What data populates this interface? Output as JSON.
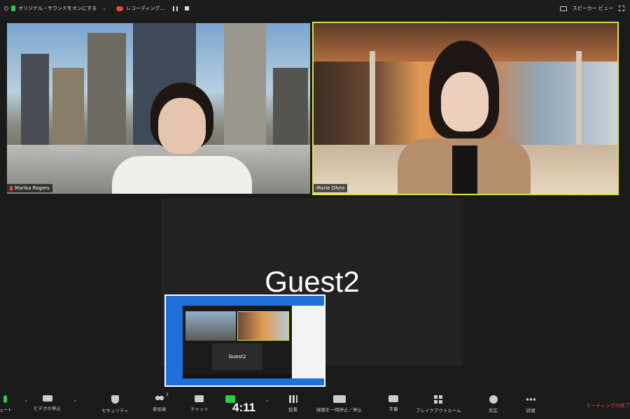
{
  "topbar": {
    "original_sound": "オリジナル・サウンドをオンにする",
    "recording": "レコーディング…",
    "speaker_view": "スピーカー ビュー"
  },
  "participants": [
    {
      "name": "Marika Rogers"
    },
    {
      "name": "Marie Ohno"
    }
  ],
  "guest": {
    "name": "Guest2"
  },
  "preview": {
    "guest_name": "Guest2"
  },
  "toolbar": {
    "mute": "ュート",
    "video": "ビデオの停止",
    "security": "セキュリティ",
    "participants": "参加者",
    "participants_count": "3",
    "chat": "チャット",
    "share": "画面",
    "poll": "投票",
    "pause_recording": "録画を一時停止／停止",
    "captions": "字幕",
    "breakout": "ブレイクアウトルーム",
    "reactions": "反応",
    "more": "詳細",
    "end": "ミーティングの終了"
  },
  "timer": "4:11",
  "colors": {
    "active_speaker": "#d6e24a",
    "mic_on": "#2ecc40",
    "recording": "#e74c3c"
  }
}
